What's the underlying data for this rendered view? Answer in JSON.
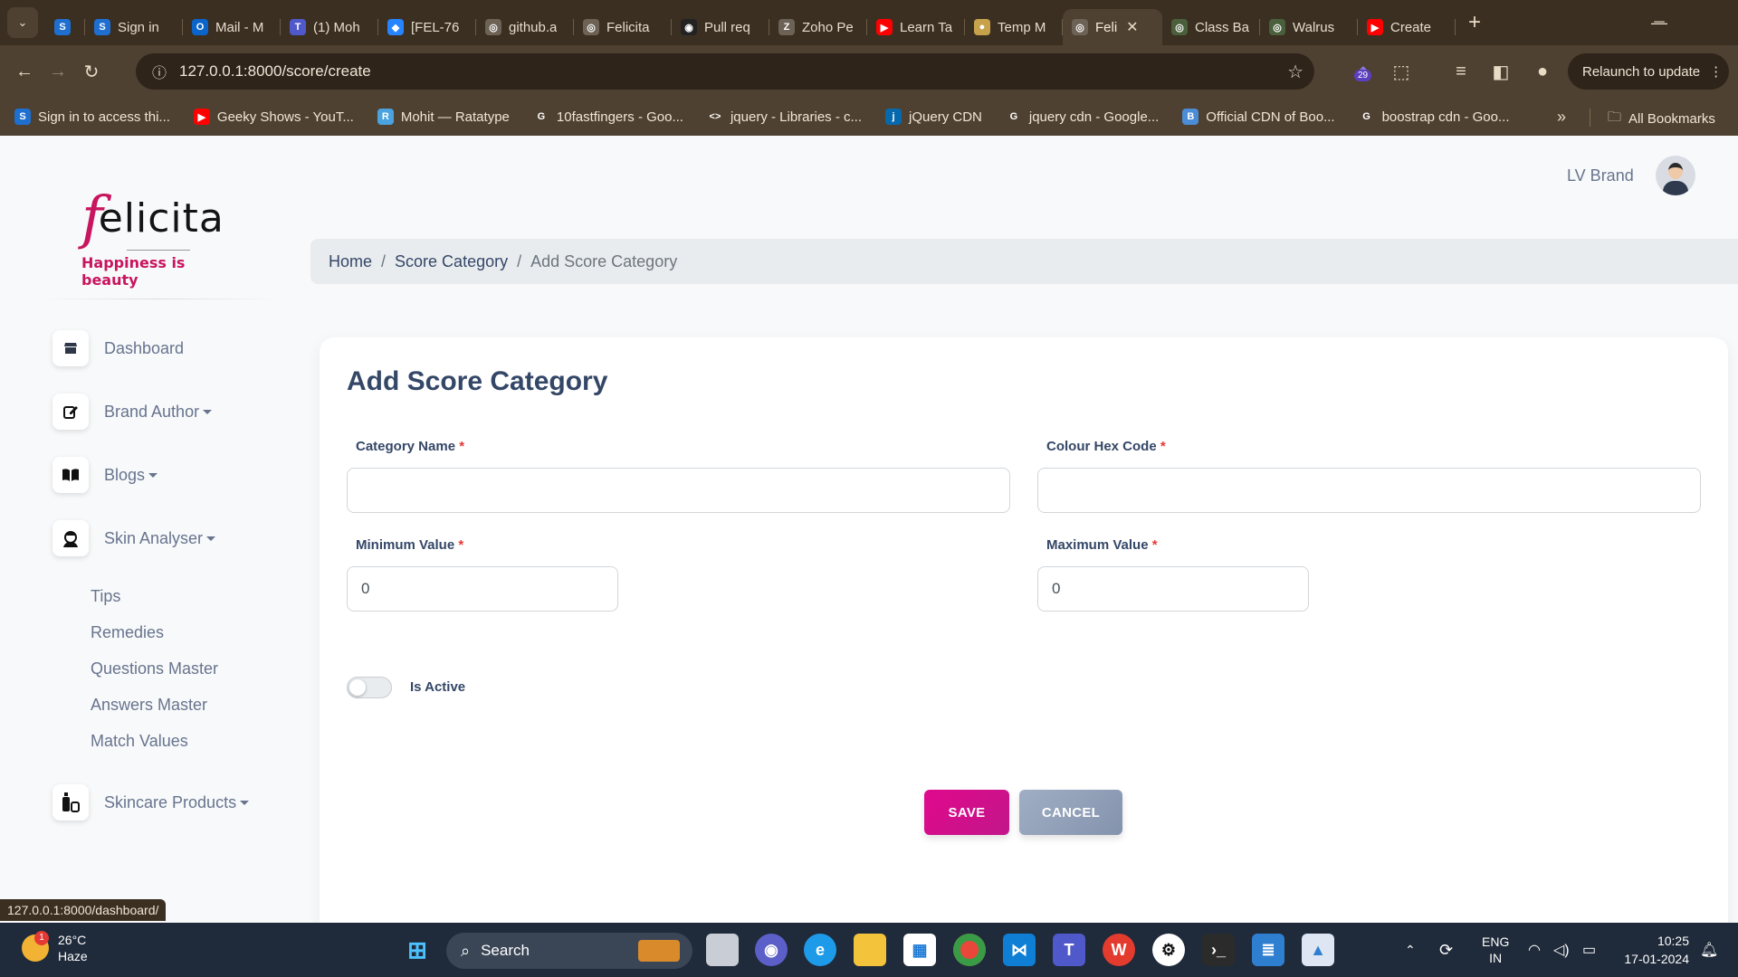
{
  "browser": {
    "tabs": [
      {
        "label": "",
        "fav": "S",
        "color": "#1f6fd1"
      },
      {
        "label": "Sign in",
        "fav": "S",
        "color": "#1f6fd1"
      },
      {
        "label": "Mail - M",
        "fav": "O",
        "color": "#0a64c9"
      },
      {
        "label": "(1) Moh",
        "fav": "T",
        "color": "#5059c9"
      },
      {
        "label": "[FEL-76",
        "fav": "◆",
        "color": "#2684ff"
      },
      {
        "label": "github.a",
        "fav": "◎",
        "color": "#6d6256"
      },
      {
        "label": "Felicita",
        "fav": "◎",
        "color": "#6d6256"
      },
      {
        "label": "Pull req",
        "fav": "◉",
        "color": "#222222"
      },
      {
        "label": "Zoho Pe",
        "fav": "Z",
        "color": "#6d6256"
      },
      {
        "label": "Learn Ta",
        "fav": "▶",
        "color": "#ff0000"
      },
      {
        "label": "Temp M",
        "fav": "●",
        "color": "#c7a24b"
      },
      {
        "label": "Feli",
        "fav": "◎",
        "color": "#6d6256",
        "active": true
      },
      {
        "label": "Class Ba",
        "fav": "◎",
        "color": "#4a5f3c"
      },
      {
        "label": "Walrus",
        "fav": "◎",
        "color": "#4a5f3c"
      },
      {
        "label": "Create",
        "fav": "▶",
        "color": "#ff0000"
      }
    ],
    "url": "127.0.0.1:8000/score/create",
    "extension_badge": "29",
    "relaunch_label": "Relaunch to update",
    "bookmarks": [
      {
        "label": "Sign in to access thi...",
        "fav": "S",
        "color": "#1f6fd1"
      },
      {
        "label": "Geeky Shows - YouT...",
        "fav": "▶",
        "color": "#ff0000"
      },
      {
        "label": "Mohit — Ratatype",
        "fav": "R",
        "color": "#4aa3df"
      },
      {
        "label": "10fastfingers - Goo...",
        "fav": "G",
        "color": "#4f4131"
      },
      {
        "label": "jquery - Libraries - c...",
        "fav": "<>",
        "color": "#4f4131"
      },
      {
        "label": "jQuery CDN",
        "fav": "j",
        "color": "#0769ad"
      },
      {
        "label": "jquery cdn - Google...",
        "fav": "G",
        "color": "#4f4131"
      },
      {
        "label": "Official CDN of Boo...",
        "fav": "B",
        "color": "#4b8cd6"
      },
      {
        "label": "boostrap cdn - Goo...",
        "fav": "G",
        "color": "#4f4131"
      }
    ],
    "all_bookmarks_label": "All Bookmarks",
    "status_url": "127.0.0.1:8000/dashboard/"
  },
  "brand": {
    "logo_first": "f",
    "logo_rest": "elicita",
    "tagline": "Happiness is beauty"
  },
  "sidebar": {
    "items": [
      {
        "label": "Dashboard",
        "icon": "store-icon"
      },
      {
        "label": "Brand Author",
        "icon": "edit-icon",
        "dropdown": true
      },
      {
        "label": "Blogs",
        "icon": "book-icon",
        "dropdown": true
      },
      {
        "label": "Skin Analyser",
        "icon": "face-icon",
        "dropdown": true
      },
      {
        "label": "Skincare Products",
        "icon": "bottles-icon",
        "dropdown": true
      }
    ],
    "skin_analyser_sub": [
      "Tips",
      "Remedies",
      "Questions Master",
      "Answers Master",
      "Match Values"
    ]
  },
  "user": {
    "name": "LV Brand"
  },
  "breadcrumb": [
    "Home",
    "Score Category",
    "Add Score Category"
  ],
  "form": {
    "title": "Add Score Category",
    "category_name_label": "Category Name",
    "category_name_value": "",
    "colour_hex_label": "Colour Hex Code",
    "colour_hex_value": "",
    "min_label": "Minimum Value",
    "min_value": "0",
    "max_label": "Maximum Value",
    "max_value": "0",
    "required_mark": "*",
    "active_label": "Is Active",
    "is_active": false,
    "save_label": "SAVE",
    "cancel_label": "CANCEL"
  },
  "taskbar": {
    "temperature": "26°C",
    "weather": "Haze",
    "notification_count": "1",
    "search_label": "Search",
    "lang_1": "ENG",
    "lang_2": "IN",
    "time": "10:25",
    "date": "17-01-2024"
  }
}
